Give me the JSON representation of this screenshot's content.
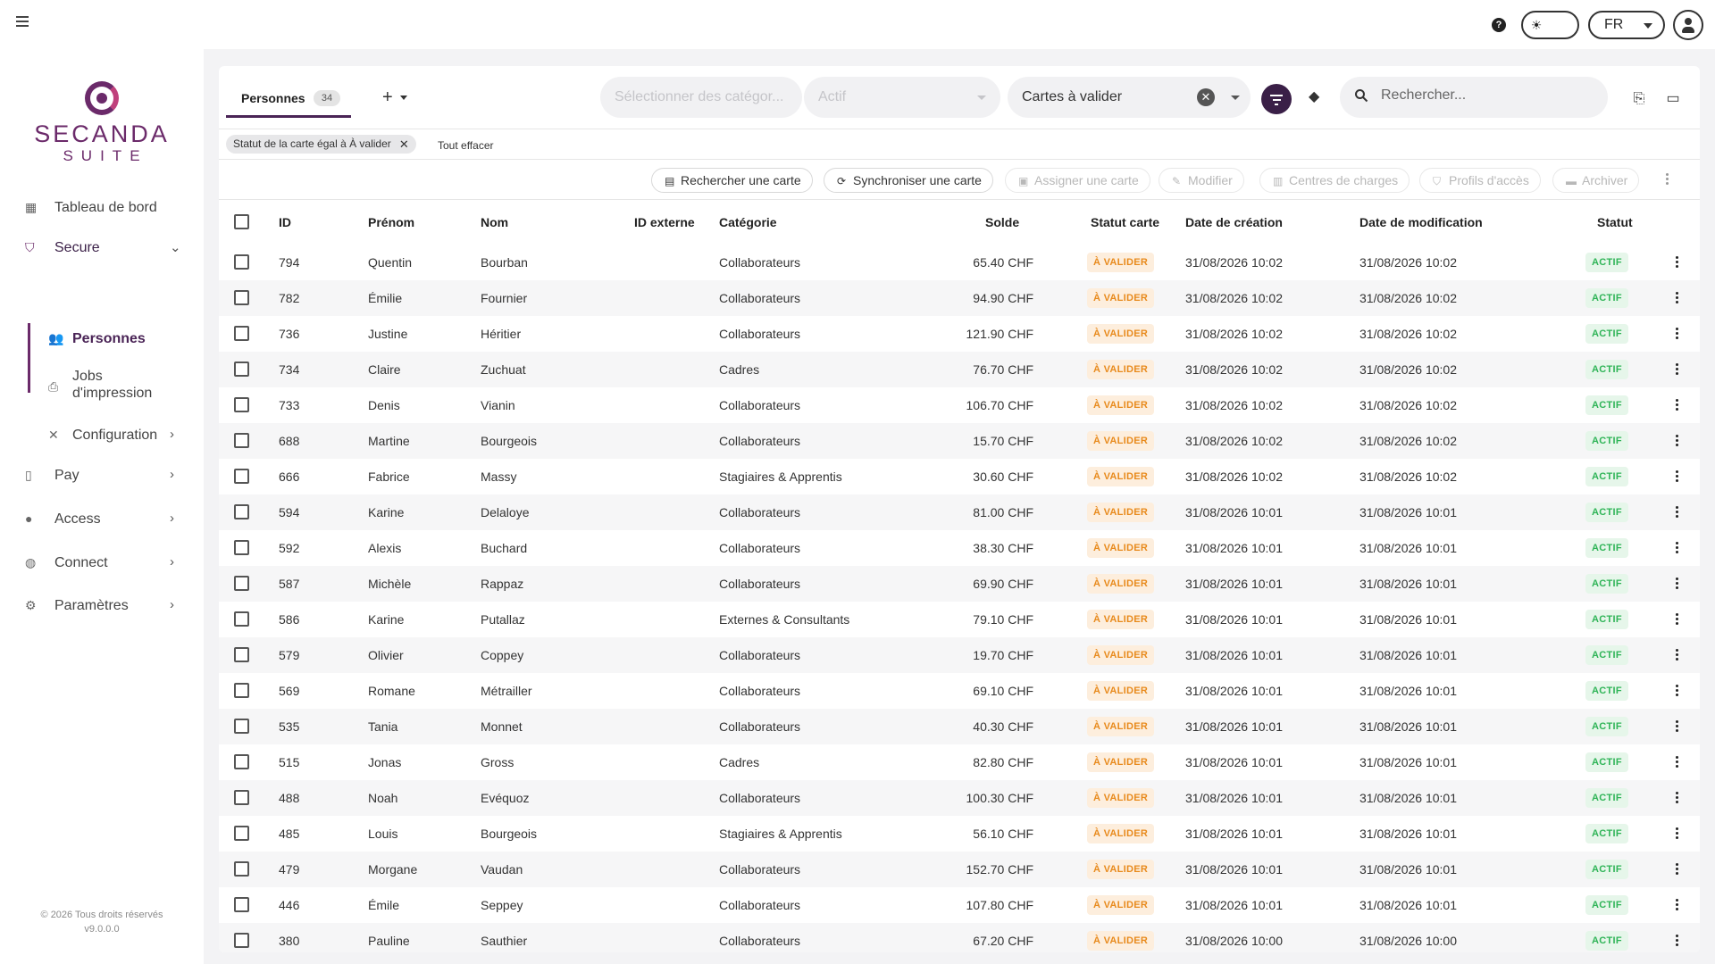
{
  "topbar": {
    "help": "?",
    "lang": "FR"
  },
  "sidebar": {
    "logo_word": "SECANDA",
    "logo_sub": "SUITE",
    "items": [
      {
        "label": "Tableau de bord",
        "icon": "dashboard-icon"
      },
      {
        "label": "Secure",
        "icon": "shield-icon"
      },
      {
        "label": "Personnes",
        "icon": "people-icon"
      },
      {
        "label": "Jobs\nd'impression",
        "icon": "printer-icon"
      },
      {
        "label": "Configuration",
        "icon": "tools-icon"
      },
      {
        "label": "Pay",
        "icon": "wallet-icon"
      },
      {
        "label": "Access",
        "icon": "lock-icon"
      },
      {
        "label": "Connect",
        "icon": "globe-icon"
      },
      {
        "label": "Paramètres",
        "icon": "gear-icon"
      }
    ],
    "copyright": "© 2026 Tous droits réservés",
    "version": "v9.0.0.0"
  },
  "tabs": {
    "personnes_label": "Personnes",
    "personnes_count": "34",
    "add": "+"
  },
  "filters": {
    "categories_placeholder": "Sélectionner des catégor...",
    "status_placeholder": "Actif",
    "cards_value": "Cartes à valider",
    "search_placeholder": "Rechercher..."
  },
  "chips": {
    "active_filter": "Statut de la carte égal à À valider",
    "clear_all": "Tout effacer"
  },
  "actions": {
    "search_card": "Rechercher une carte",
    "sync_card": "Synchroniser une carte",
    "assign_card": "Assigner une carte",
    "modify": "Modifier",
    "cost_centers": "Centres de charges",
    "access_profiles": "Profils d'accès",
    "archive": "Archiver"
  },
  "table": {
    "columns": [
      "ID",
      "Prénom",
      "Nom",
      "ID externe",
      "Catégorie",
      "Solde",
      "Statut carte",
      "Date de création",
      "Date de modification",
      "Statut"
    ],
    "rows": [
      {
        "id": "794",
        "first": "Quentin",
        "last": "Bourban",
        "cat": "Collaborateurs",
        "solde": "65.40 CHF",
        "card": "À VALIDER",
        "created": "31/08/2026 10:02",
        "modified": "31/08/2026 10:02",
        "status": "ACTIF"
      },
      {
        "id": "782",
        "first": "Émilie",
        "last": "Fournier",
        "cat": "Collaborateurs",
        "solde": "94.90 CHF",
        "card": "À VALIDER",
        "created": "31/08/2026 10:02",
        "modified": "31/08/2026 10:02",
        "status": "ACTIF"
      },
      {
        "id": "736",
        "first": "Justine",
        "last": "Héritier",
        "cat": "Collaborateurs",
        "solde": "121.90 CHF",
        "card": "À VALIDER",
        "created": "31/08/2026 10:02",
        "modified": "31/08/2026 10:02",
        "status": "ACTIF"
      },
      {
        "id": "734",
        "first": "Claire",
        "last": "Zuchuat",
        "cat": "Cadres",
        "solde": "76.70 CHF",
        "card": "À VALIDER",
        "created": "31/08/2026 10:02",
        "modified": "31/08/2026 10:02",
        "status": "ACTIF"
      },
      {
        "id": "733",
        "first": "Denis",
        "last": "Vianin",
        "cat": "Collaborateurs",
        "solde": "106.70 CHF",
        "card": "À VALIDER",
        "created": "31/08/2026 10:02",
        "modified": "31/08/2026 10:02",
        "status": "ACTIF"
      },
      {
        "id": "688",
        "first": "Martine",
        "last": "Bourgeois",
        "cat": "Collaborateurs",
        "solde": "15.70 CHF",
        "card": "À VALIDER",
        "created": "31/08/2026 10:02",
        "modified": "31/08/2026 10:02",
        "status": "ACTIF"
      },
      {
        "id": "666",
        "first": "Fabrice",
        "last": "Massy",
        "cat": "Stagiaires & Apprentis",
        "solde": "30.60 CHF",
        "card": "À VALIDER",
        "created": "31/08/2026 10:02",
        "modified": "31/08/2026 10:02",
        "status": "ACTIF"
      },
      {
        "id": "594",
        "first": "Karine",
        "last": "Delaloye",
        "cat": "Collaborateurs",
        "solde": "81.00 CHF",
        "card": "À VALIDER",
        "created": "31/08/2026 10:01",
        "modified": "31/08/2026 10:01",
        "status": "ACTIF"
      },
      {
        "id": "592",
        "first": "Alexis",
        "last": "Buchard",
        "cat": "Collaborateurs",
        "solde": "38.30 CHF",
        "card": "À VALIDER",
        "created": "31/08/2026 10:01",
        "modified": "31/08/2026 10:01",
        "status": "ACTIF"
      },
      {
        "id": "587",
        "first": "Michèle",
        "last": "Rappaz",
        "cat": "Collaborateurs",
        "solde": "69.90 CHF",
        "card": "À VALIDER",
        "created": "31/08/2026 10:01",
        "modified": "31/08/2026 10:01",
        "status": "ACTIF"
      },
      {
        "id": "586",
        "first": "Karine",
        "last": "Putallaz",
        "cat": "Externes & Consultants",
        "solde": "79.10 CHF",
        "card": "À VALIDER",
        "created": "31/08/2026 10:01",
        "modified": "31/08/2026 10:01",
        "status": "ACTIF"
      },
      {
        "id": "579",
        "first": "Olivier",
        "last": "Coppey",
        "cat": "Collaborateurs",
        "solde": "19.70 CHF",
        "card": "À VALIDER",
        "created": "31/08/2026 10:01",
        "modified": "31/08/2026 10:01",
        "status": "ACTIF"
      },
      {
        "id": "569",
        "first": "Romane",
        "last": "Métrailler",
        "cat": "Collaborateurs",
        "solde": "69.10 CHF",
        "card": "À VALIDER",
        "created": "31/08/2026 10:01",
        "modified": "31/08/2026 10:01",
        "status": "ACTIF"
      },
      {
        "id": "535",
        "first": "Tania",
        "last": "Monnet",
        "cat": "Collaborateurs",
        "solde": "40.30 CHF",
        "card": "À VALIDER",
        "created": "31/08/2026 10:01",
        "modified": "31/08/2026 10:01",
        "status": "ACTIF"
      },
      {
        "id": "515",
        "first": "Jonas",
        "last": "Gross",
        "cat": "Cadres",
        "solde": "82.80 CHF",
        "card": "À VALIDER",
        "created": "31/08/2026 10:01",
        "modified": "31/08/2026 10:01",
        "status": "ACTIF"
      },
      {
        "id": "488",
        "first": "Noah",
        "last": "Evéquoz",
        "cat": "Collaborateurs",
        "solde": "100.30 CHF",
        "card": "À VALIDER",
        "created": "31/08/2026 10:01",
        "modified": "31/08/2026 10:01",
        "status": "ACTIF"
      },
      {
        "id": "485",
        "first": "Louis",
        "last": "Bourgeois",
        "cat": "Stagiaires & Apprentis",
        "solde": "56.10 CHF",
        "card": "À VALIDER",
        "created": "31/08/2026 10:01",
        "modified": "31/08/2026 10:01",
        "status": "ACTIF"
      },
      {
        "id": "479",
        "first": "Morgane",
        "last": "Vaudan",
        "cat": "Collaborateurs",
        "solde": "152.70 CHF",
        "card": "À VALIDER",
        "created": "31/08/2026 10:01",
        "modified": "31/08/2026 10:01",
        "status": "ACTIF"
      },
      {
        "id": "446",
        "first": "Émile",
        "last": "Seppey",
        "cat": "Collaborateurs",
        "solde": "107.80 CHF",
        "card": "À VALIDER",
        "created": "31/08/2026 10:01",
        "modified": "31/08/2026 10:01",
        "status": "ACTIF"
      },
      {
        "id": "380",
        "first": "Pauline",
        "last": "Sauthier",
        "cat": "Collaborateurs",
        "solde": "67.20 CHF",
        "card": "À VALIDER",
        "created": "31/08/2026 10:00",
        "modified": "31/08/2026 10:00",
        "status": "ACTIF"
      }
    ]
  },
  "colors": {
    "brand": "#6b2a6a",
    "accent": "#3a1f47",
    "badge_validate_text": "#e88a1c",
    "badge_validate_bg": "#fdeedd",
    "badge_active_text": "#2fb457",
    "badge_active_bg": "#e6f6ea"
  }
}
